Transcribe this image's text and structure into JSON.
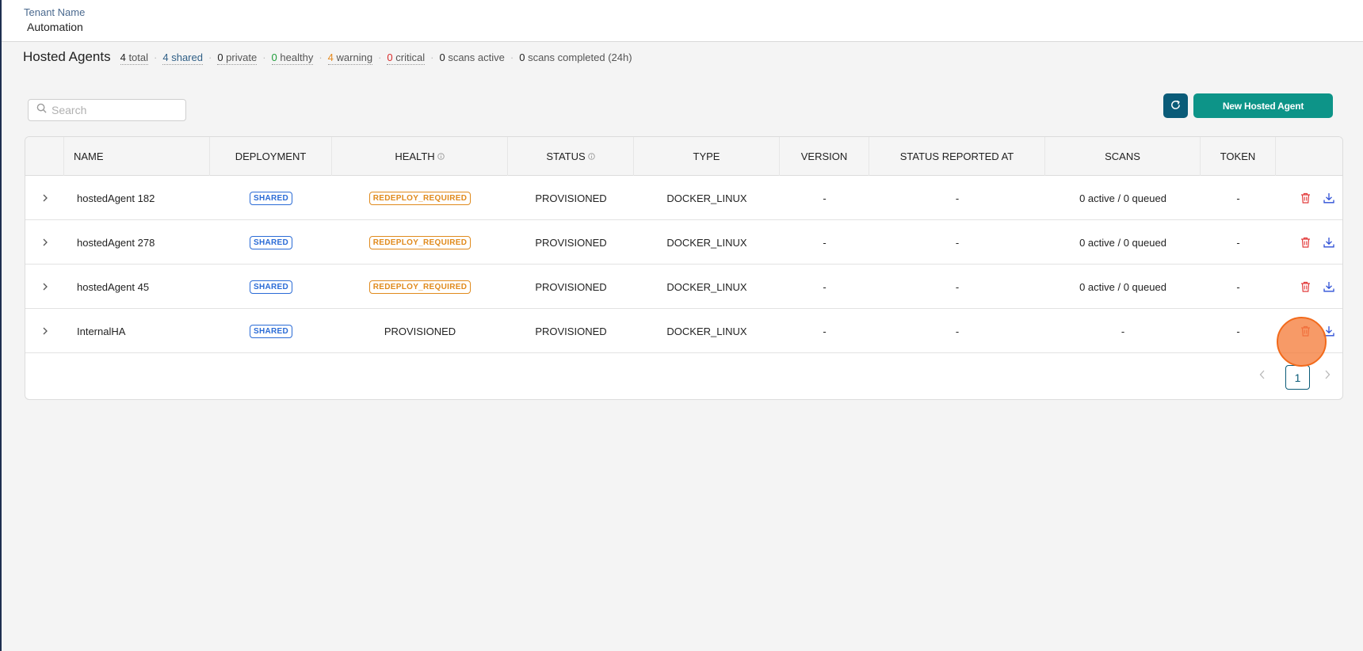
{
  "tenant": {
    "label": "Tenant Name",
    "value": "Automation"
  },
  "summary": {
    "title": "Hosted Agents",
    "stats": [
      {
        "count": "4",
        "label": "total",
        "color": "#222222"
      },
      {
        "count": "4",
        "label": "shared",
        "color": "#2f5f86"
      },
      {
        "count": "0",
        "label": "private",
        "color": "#222222"
      },
      {
        "count": "0",
        "label": "healthy",
        "color": "#1f9d3a"
      },
      {
        "count": "4",
        "label": "warning",
        "color": "#e5891c"
      },
      {
        "count": "0",
        "label": "critical",
        "color": "#d92d2d"
      },
      {
        "count": "0",
        "label": "scans active",
        "color": "#222222"
      },
      {
        "count": "0",
        "label": "scans completed (24h)",
        "color": "#222222"
      }
    ]
  },
  "search": {
    "placeholder": "Search",
    "value": ""
  },
  "toolbar": {
    "refresh_icon": "refresh-icon",
    "new_label": "New Hosted Agent"
  },
  "columns": {
    "name": "NAME",
    "deployment": "DEPLOYMENT",
    "health": "HEALTH",
    "status": "STATUS",
    "type": "TYPE",
    "version": "VERSION",
    "reported": "STATUS REPORTED AT",
    "scans": "SCANS",
    "token": "TOKEN"
  },
  "rows": [
    {
      "name": "hostedAgent 182",
      "deployment": "SHARED",
      "health": "REDEPLOY_REQUIRED",
      "status": "PROVISIONED",
      "type": "DOCKER_LINUX",
      "version": "-",
      "reported": "-",
      "scans": "0 active / 0 queued",
      "token": "-"
    },
    {
      "name": "hostedAgent 278",
      "deployment": "SHARED",
      "health": "REDEPLOY_REQUIRED",
      "status": "PROVISIONED",
      "type": "DOCKER_LINUX",
      "version": "-",
      "reported": "-",
      "scans": "0 active / 0 queued",
      "token": "-"
    },
    {
      "name": "hostedAgent 45",
      "deployment": "SHARED",
      "health": "REDEPLOY_REQUIRED",
      "status": "PROVISIONED",
      "type": "DOCKER_LINUX",
      "version": "-",
      "reported": "-",
      "scans": "0 active / 0 queued",
      "token": "-"
    },
    {
      "name": "InternalHA",
      "deployment": "SHARED",
      "health": "PROVISIONED",
      "status": "PROVISIONED",
      "type": "DOCKER_LINUX",
      "version": "-",
      "reported": "-",
      "scans": "-",
      "token": "-"
    }
  ],
  "pagination": {
    "current_page": "1"
  },
  "colors": {
    "accent": "#0d9488",
    "dark_accent": "#0a5b78",
    "delete": "#e23b3b",
    "download": "#2d4fd6"
  }
}
